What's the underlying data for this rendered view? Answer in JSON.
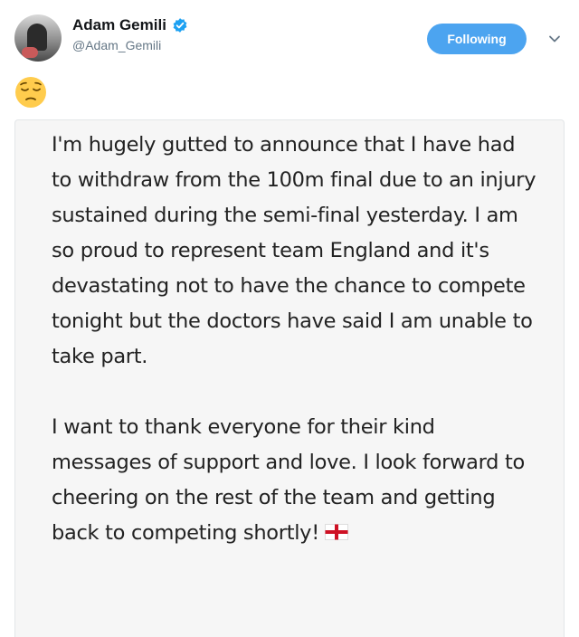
{
  "tweet": {
    "author": {
      "display_name": "Adam Gemili",
      "handle": "@Adam_Gemili",
      "verified": true,
      "avatar": "avatar-photo"
    },
    "follow_button_label": "Following",
    "menu_icon": "chevron-down-icon",
    "reaction_emoji": "pensive-face-emoji",
    "statement_image": {
      "paragraphs": [
        "I'm hugely gutted to announce that I have had to withdraw from the 100m final due to an injury sustained during the semi-final yesterday. I am so proud to represent team England and it's devastating not to have the chance to compete tonight but the doctors have said I am unable to take part.",
        "I want to thank everyone for their kind messages of support and love. I look forward to cheering on the rest of the team and getting back to competing shortly!"
      ],
      "trailing_icon": "england-flag-icon"
    }
  },
  "colors": {
    "follow_button_bg": "#4ca4f0",
    "verified_badge": "#1da1f2",
    "handle_text": "#657786",
    "card_bg": "#f6f6f6"
  }
}
